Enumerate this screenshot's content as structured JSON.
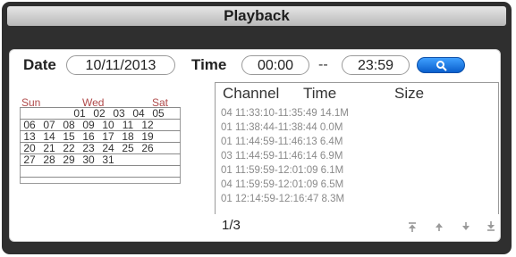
{
  "window": {
    "title": "Playback"
  },
  "filter": {
    "date_label": "Date",
    "date_value": "10/11/2013",
    "time_label": "Time",
    "time_start": "00:00",
    "time_separator": "--",
    "time_end": "23:59",
    "search_icon": "search-icon"
  },
  "calendar": {
    "headers": [
      "Sun",
      "Wed",
      "Sat"
    ],
    "rows": [
      [
        "",
        "",
        "",
        "01",
        "02",
        "03",
        "04",
        "05"
      ],
      [
        "06",
        "07",
        "08",
        "09",
        "10",
        "11",
        "12"
      ],
      [
        "13",
        "14",
        "15",
        "16",
        "17",
        "18",
        "19"
      ],
      [
        "20",
        "21",
        "22",
        "23",
        "24",
        "25",
        "26"
      ],
      [
        "27",
        "28",
        "29",
        "30",
        "31",
        "",
        ""
      ],
      [
        "",
        "",
        "",
        "",
        "",
        "",
        ""
      ]
    ]
  },
  "records": {
    "columns": [
      "Channel",
      "Time",
      "Size"
    ],
    "items": [
      "04 11:33:10-11:35:49  14.1M",
      "01 11:38:44-11:38:44  0.0M",
      "01 11:44:59-11:46:13  6.4M",
      "03 11:44:59-11:46:14  6.9M",
      "01 11:59:59-12:01:09  6.1M",
      "04 11:59:59-12:01:09  6.5M",
      "01 12:14:59-12:16:47  8.3M"
    ]
  },
  "pager": {
    "page": "1/3",
    "buttons": [
      "first-page-icon",
      "prev-page-icon",
      "next-page-icon",
      "last-page-icon"
    ]
  }
}
